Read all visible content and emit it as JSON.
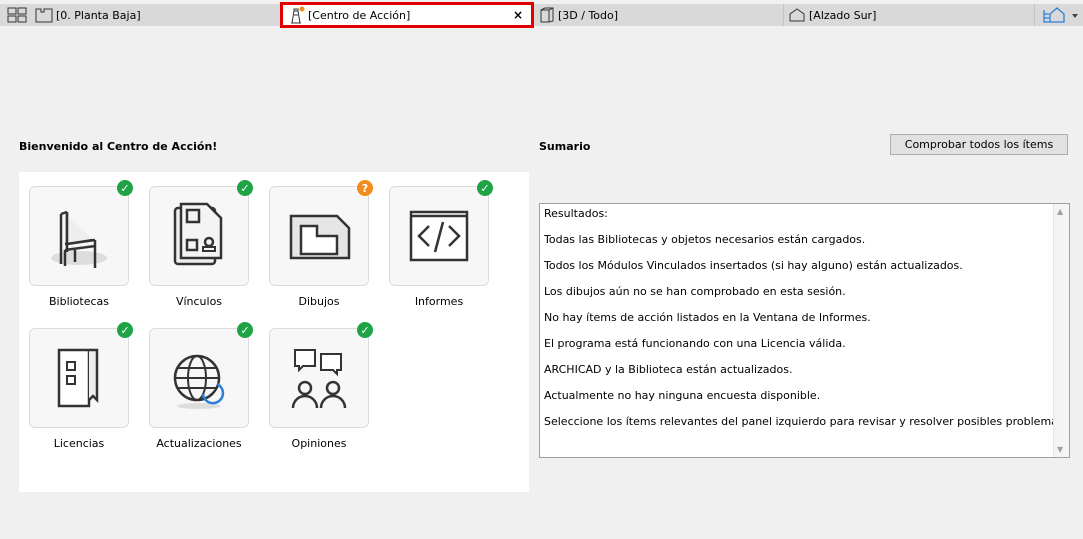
{
  "tabs": [
    {
      "label": "[0. Planta Baja]",
      "icon": "floor-plan-icon"
    },
    {
      "label": "[Centro de Acción]",
      "icon": "lighthouse-icon",
      "active": true,
      "close": "×"
    },
    {
      "label": "[3D / Todo]",
      "icon": "3d-box-icon"
    },
    {
      "label": "[Alzado Sur]",
      "icon": "elevation-icon"
    }
  ],
  "accent_color": "#e00000",
  "left": {
    "title": "Bienvenido al Centro de Acción!",
    "items": [
      {
        "label": "Bibliotecas",
        "status": "ok",
        "icon": "chair-icon"
      },
      {
        "label": "Vínculos",
        "status": "ok",
        "icon": "linked-files-icon"
      },
      {
        "label": "Dibujos",
        "status": "unknown",
        "badge": "?",
        "icon": "drawing-icon"
      },
      {
        "label": "Informes",
        "status": "ok",
        "icon": "code-report-icon"
      },
      {
        "label": "Licencias",
        "status": "ok",
        "icon": "license-icon"
      },
      {
        "label": "Actualizaciones",
        "status": "ok",
        "icon": "globe-update-icon"
      },
      {
        "label": "Opiniones",
        "status": "ok",
        "icon": "feedback-icon"
      }
    ],
    "status_colors": {
      "ok": "#1ea446",
      "unknown": "#f28c1e"
    }
  },
  "right": {
    "title": "Sumario",
    "check_all": "Comprobar todos los ítems",
    "results": [
      "Resultados:",
      "Todas las Bibliotecas y objetos necesarios están cargados.",
      "Todos los Módulos Vinculados insertados (si hay alguno) están actualizados.",
      "Los dibujos aún no se han comprobado en esta sesión.",
      "No hay ítems de acción listados en la Ventana de Informes.",
      "El programa está funcionando con una Licencia válida.",
      "ARCHICAD y la Biblioteca están actualizados.",
      "Actualmente no hay ninguna encuesta disponible.",
      "Seleccione los ítems relevantes del panel izquierdo para revisar y resolver posibles problemas."
    ]
  }
}
